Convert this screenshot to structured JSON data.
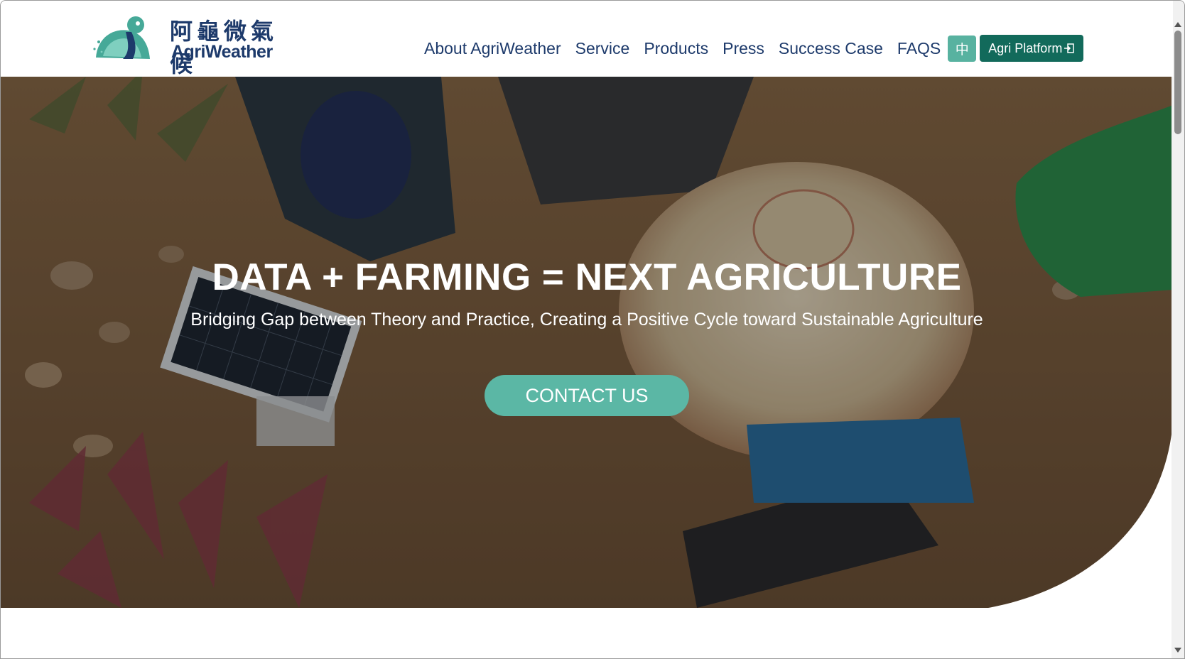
{
  "brand": {
    "name_cn": "阿龜微氣候",
    "name_en": "AgriWeather"
  },
  "nav": {
    "items": [
      {
        "label": "About AgriWeather"
      },
      {
        "label": "Service"
      },
      {
        "label": "Products"
      },
      {
        "label": "Press"
      },
      {
        "label": "Success Case"
      },
      {
        "label": "FAQS"
      }
    ],
    "lang_label": "中",
    "platform_label": "Agri Platform",
    "platform_icon": "login-icon"
  },
  "hero": {
    "title": "DATA + FARMING = NEXT AGRICULTURE",
    "subtitle": "Bridging Gap between Theory and Practice, Creating a Positive Cycle toward Sustainable Agriculture",
    "cta_label": "CONTACT US"
  },
  "colors": {
    "brand_navy": "#1d3a6b",
    "accent_teal": "#58b2a0",
    "platform_green": "#126a5b",
    "cta_teal": "#5bb7a5"
  }
}
